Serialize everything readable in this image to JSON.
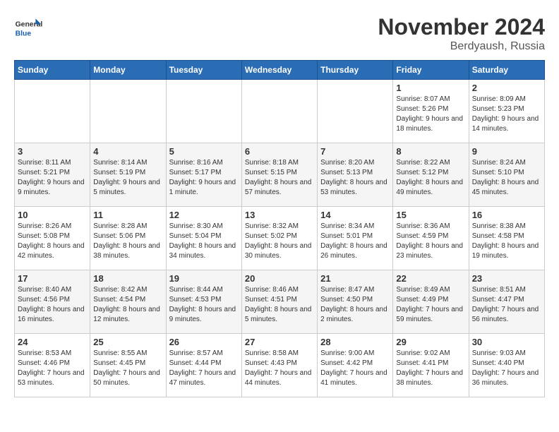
{
  "logo": {
    "general": "General",
    "blue": "Blue"
  },
  "title": "November 2024",
  "location": "Berdyaush, Russia",
  "days_header": [
    "Sunday",
    "Monday",
    "Tuesday",
    "Wednesday",
    "Thursday",
    "Friday",
    "Saturday"
  ],
  "weeks": [
    [
      {
        "day": "",
        "info": ""
      },
      {
        "day": "",
        "info": ""
      },
      {
        "day": "",
        "info": ""
      },
      {
        "day": "",
        "info": ""
      },
      {
        "day": "",
        "info": ""
      },
      {
        "day": "1",
        "info": "Sunrise: 8:07 AM\nSunset: 5:26 PM\nDaylight: 9 hours and 18 minutes."
      },
      {
        "day": "2",
        "info": "Sunrise: 8:09 AM\nSunset: 5:23 PM\nDaylight: 9 hours and 14 minutes."
      }
    ],
    [
      {
        "day": "3",
        "info": "Sunrise: 8:11 AM\nSunset: 5:21 PM\nDaylight: 9 hours and 9 minutes."
      },
      {
        "day": "4",
        "info": "Sunrise: 8:14 AM\nSunset: 5:19 PM\nDaylight: 9 hours and 5 minutes."
      },
      {
        "day": "5",
        "info": "Sunrise: 8:16 AM\nSunset: 5:17 PM\nDaylight: 9 hours and 1 minute."
      },
      {
        "day": "6",
        "info": "Sunrise: 8:18 AM\nSunset: 5:15 PM\nDaylight: 8 hours and 57 minutes."
      },
      {
        "day": "7",
        "info": "Sunrise: 8:20 AM\nSunset: 5:13 PM\nDaylight: 8 hours and 53 minutes."
      },
      {
        "day": "8",
        "info": "Sunrise: 8:22 AM\nSunset: 5:12 PM\nDaylight: 8 hours and 49 minutes."
      },
      {
        "day": "9",
        "info": "Sunrise: 8:24 AM\nSunset: 5:10 PM\nDaylight: 8 hours and 45 minutes."
      }
    ],
    [
      {
        "day": "10",
        "info": "Sunrise: 8:26 AM\nSunset: 5:08 PM\nDaylight: 8 hours and 42 minutes."
      },
      {
        "day": "11",
        "info": "Sunrise: 8:28 AM\nSunset: 5:06 PM\nDaylight: 8 hours and 38 minutes."
      },
      {
        "day": "12",
        "info": "Sunrise: 8:30 AM\nSunset: 5:04 PM\nDaylight: 8 hours and 34 minutes."
      },
      {
        "day": "13",
        "info": "Sunrise: 8:32 AM\nSunset: 5:02 PM\nDaylight: 8 hours and 30 minutes."
      },
      {
        "day": "14",
        "info": "Sunrise: 8:34 AM\nSunset: 5:01 PM\nDaylight: 8 hours and 26 minutes."
      },
      {
        "day": "15",
        "info": "Sunrise: 8:36 AM\nSunset: 4:59 PM\nDaylight: 8 hours and 23 minutes."
      },
      {
        "day": "16",
        "info": "Sunrise: 8:38 AM\nSunset: 4:58 PM\nDaylight: 8 hours and 19 minutes."
      }
    ],
    [
      {
        "day": "17",
        "info": "Sunrise: 8:40 AM\nSunset: 4:56 PM\nDaylight: 8 hours and 16 minutes."
      },
      {
        "day": "18",
        "info": "Sunrise: 8:42 AM\nSunset: 4:54 PM\nDaylight: 8 hours and 12 minutes."
      },
      {
        "day": "19",
        "info": "Sunrise: 8:44 AM\nSunset: 4:53 PM\nDaylight: 8 hours and 9 minutes."
      },
      {
        "day": "20",
        "info": "Sunrise: 8:46 AM\nSunset: 4:51 PM\nDaylight: 8 hours and 5 minutes."
      },
      {
        "day": "21",
        "info": "Sunrise: 8:47 AM\nSunset: 4:50 PM\nDaylight: 8 hours and 2 minutes."
      },
      {
        "day": "22",
        "info": "Sunrise: 8:49 AM\nSunset: 4:49 PM\nDaylight: 7 hours and 59 minutes."
      },
      {
        "day": "23",
        "info": "Sunrise: 8:51 AM\nSunset: 4:47 PM\nDaylight: 7 hours and 56 minutes."
      }
    ],
    [
      {
        "day": "24",
        "info": "Sunrise: 8:53 AM\nSunset: 4:46 PM\nDaylight: 7 hours and 53 minutes."
      },
      {
        "day": "25",
        "info": "Sunrise: 8:55 AM\nSunset: 4:45 PM\nDaylight: 7 hours and 50 minutes."
      },
      {
        "day": "26",
        "info": "Sunrise: 8:57 AM\nSunset: 4:44 PM\nDaylight: 7 hours and 47 minutes."
      },
      {
        "day": "27",
        "info": "Sunrise: 8:58 AM\nSunset: 4:43 PM\nDaylight: 7 hours and 44 minutes."
      },
      {
        "day": "28",
        "info": "Sunrise: 9:00 AM\nSunset: 4:42 PM\nDaylight: 7 hours and 41 minutes."
      },
      {
        "day": "29",
        "info": "Sunrise: 9:02 AM\nSunset: 4:41 PM\nDaylight: 7 hours and 38 minutes."
      },
      {
        "day": "30",
        "info": "Sunrise: 9:03 AM\nSunset: 4:40 PM\nDaylight: 7 hours and 36 minutes."
      }
    ]
  ]
}
